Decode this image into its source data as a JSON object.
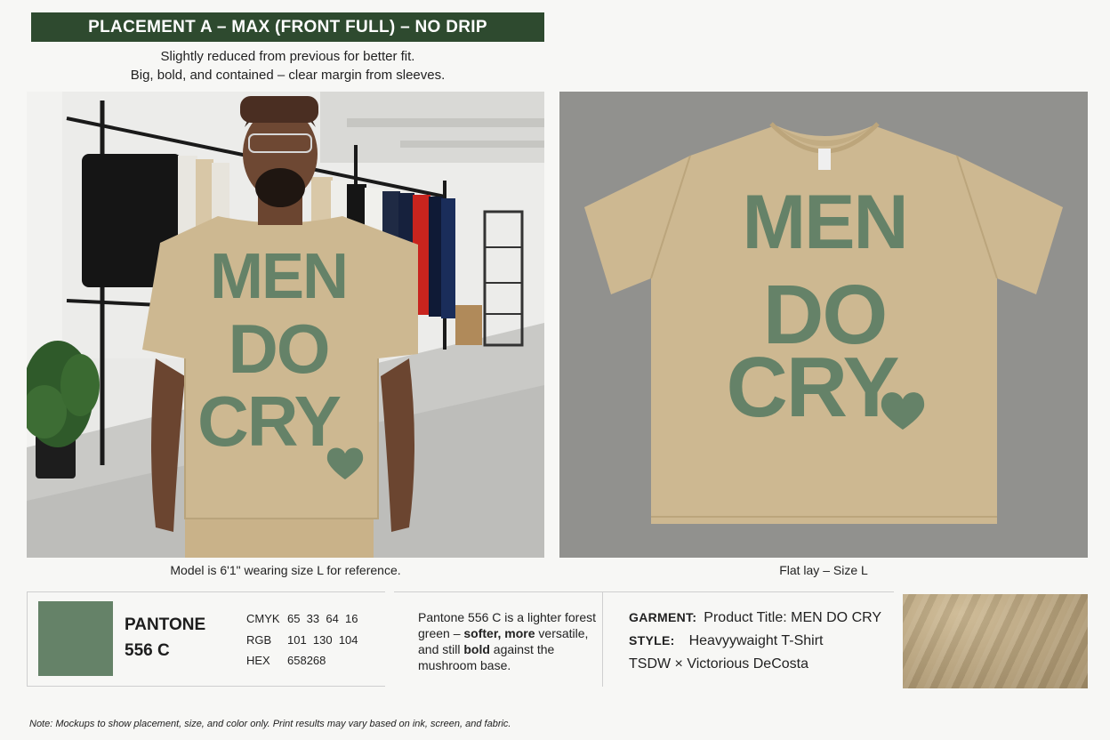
{
  "header": {
    "title": "PLACEMENT A – MAX (FRONT FULL) – NO DRIP",
    "subtitle_line1": "Slightly reduced from previous for better fit.",
    "subtitle_line2": "Big, bold, and contained – clear margin from sleeves."
  },
  "mockups": {
    "model_caption": "Model is 6'1\" wearing size L for reference.",
    "flatlay_caption": "Flat lay – Size L",
    "print_lines": [
      "MEN",
      "DO",
      "CRY"
    ]
  },
  "color": {
    "pantone_name_line1": "PANTONE",
    "pantone_name_line2": "556 C",
    "cmyk_label": "CMYK",
    "cmyk_value": "65  33  64  16",
    "rgb_label": "RGB",
    "rgb_value": "101  130  104",
    "hex_label": "HEX",
    "hex_value": "658268",
    "swatch_hex": "#658268",
    "description_part1": "Pantone 556 C is a lighter forest green – ",
    "description_bold1": "softer, more",
    "description_part2": " versatile, and still ",
    "description_bold2": "bold",
    "description_part3": " against the mushroom base."
  },
  "garment": {
    "garment_label": "GARMENT:",
    "garment_value": "Product Title: MEN DO CRY",
    "style_label": "STYLE:",
    "style_value": "Heavyywaight T-Shirt",
    "brand_line": "TSDW × Victorious DeCosta"
  },
  "colors": {
    "header_bg": "#2e4a2f",
    "print_green": "#658268",
    "shirt_tan": "#cdb891"
  },
  "footnote": "Note: Mockups to show placement, size, and color only. Print results may vary based on ink, screen, and fabric."
}
